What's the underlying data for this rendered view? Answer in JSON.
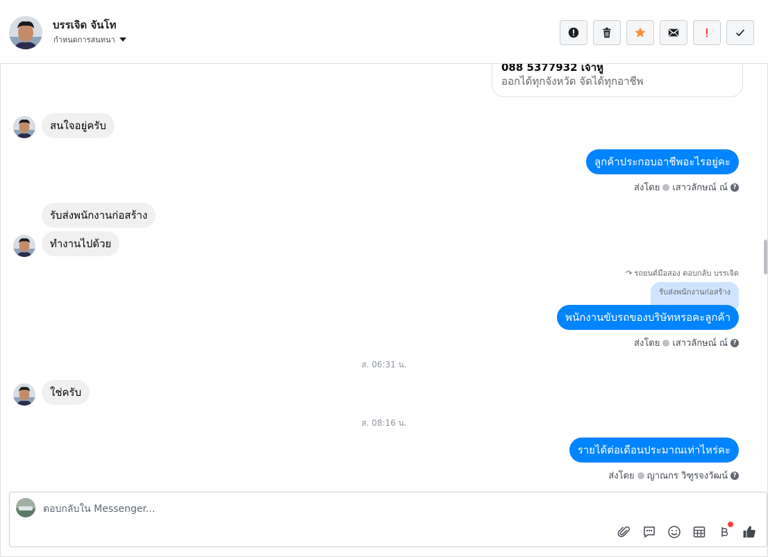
{
  "header": {
    "contact_name": "บรรเจิด จันโท",
    "assign_label": "กำหนดการสนทนา",
    "actions": [
      {
        "name": "report-spam-button",
        "icon": "alert-circle-icon",
        "color": "#1c1e21"
      },
      {
        "name": "delete-button",
        "icon": "trash-icon",
        "color": "#1c1e21"
      },
      {
        "name": "star-button",
        "icon": "star-icon",
        "color": "#f7923b"
      },
      {
        "name": "mark-unread-button",
        "icon": "envelope-icon",
        "color": "#1c1e21"
      },
      {
        "name": "follow-up-button",
        "icon": "exclamation-icon",
        "color": "#fa3e3e"
      },
      {
        "name": "mark-done-button",
        "icon": "check-icon",
        "color": "#1c1e21"
      }
    ]
  },
  "messages": {
    "card_phone": "088 5377932 เจ้าหู",
    "card_desc": "ออกได้ทุกจังหวัด จัดได้ทุกอาชีพ",
    "in_1": "สนใจอยู่ครับ",
    "out_1": "ลูกค้าประกอบอาชีพอะไรอยู่คะ",
    "out_1_sent_by": "ส่งโดย",
    "out_1_agent": "เสาวลักษณ์ ณ์",
    "in_2": "รับส่งพนักงานก่อสร้าง",
    "in_3": "ทำงานไปด้วย",
    "reply_meta": "รถยนต์มือสอง ตอบกลับ บรรเจิด",
    "quoted_text": "รับส่งพนักงานก่อสร้าง",
    "out_2": "พนักงานขับรถของบริษัทหรอคะลูกค้า",
    "out_2_sent_by": "ส่งโดย",
    "out_2_agent": "เสาวลักษณ์ ณ์",
    "time_1": "ส. 06:31 น.",
    "in_4": "ใช่ครับ",
    "time_2": "ส. 08:16 น.",
    "out_3": "รายได้ต่อเดือนประมาณเท่าไหร่คะ",
    "out_3_sent_by": "ส่งโดย",
    "out_3_agent": "ญาณกร วิฑูรจงวัฒน์"
  },
  "composer": {
    "placeholder": "ตอบกลับใน Messenger...",
    "tools": [
      "paperclip-icon",
      "saved-reply-icon",
      "emoji-icon",
      "appointment-icon",
      "baht-payment-icon",
      "like-icon"
    ]
  },
  "colors": {
    "outgoing_bubble": "#0084ff",
    "incoming_bubble": "#f0f0f0",
    "quoted_bubble": "#cfe5ff",
    "star": "#f7923b",
    "follow_up": "#fa3e3e"
  }
}
